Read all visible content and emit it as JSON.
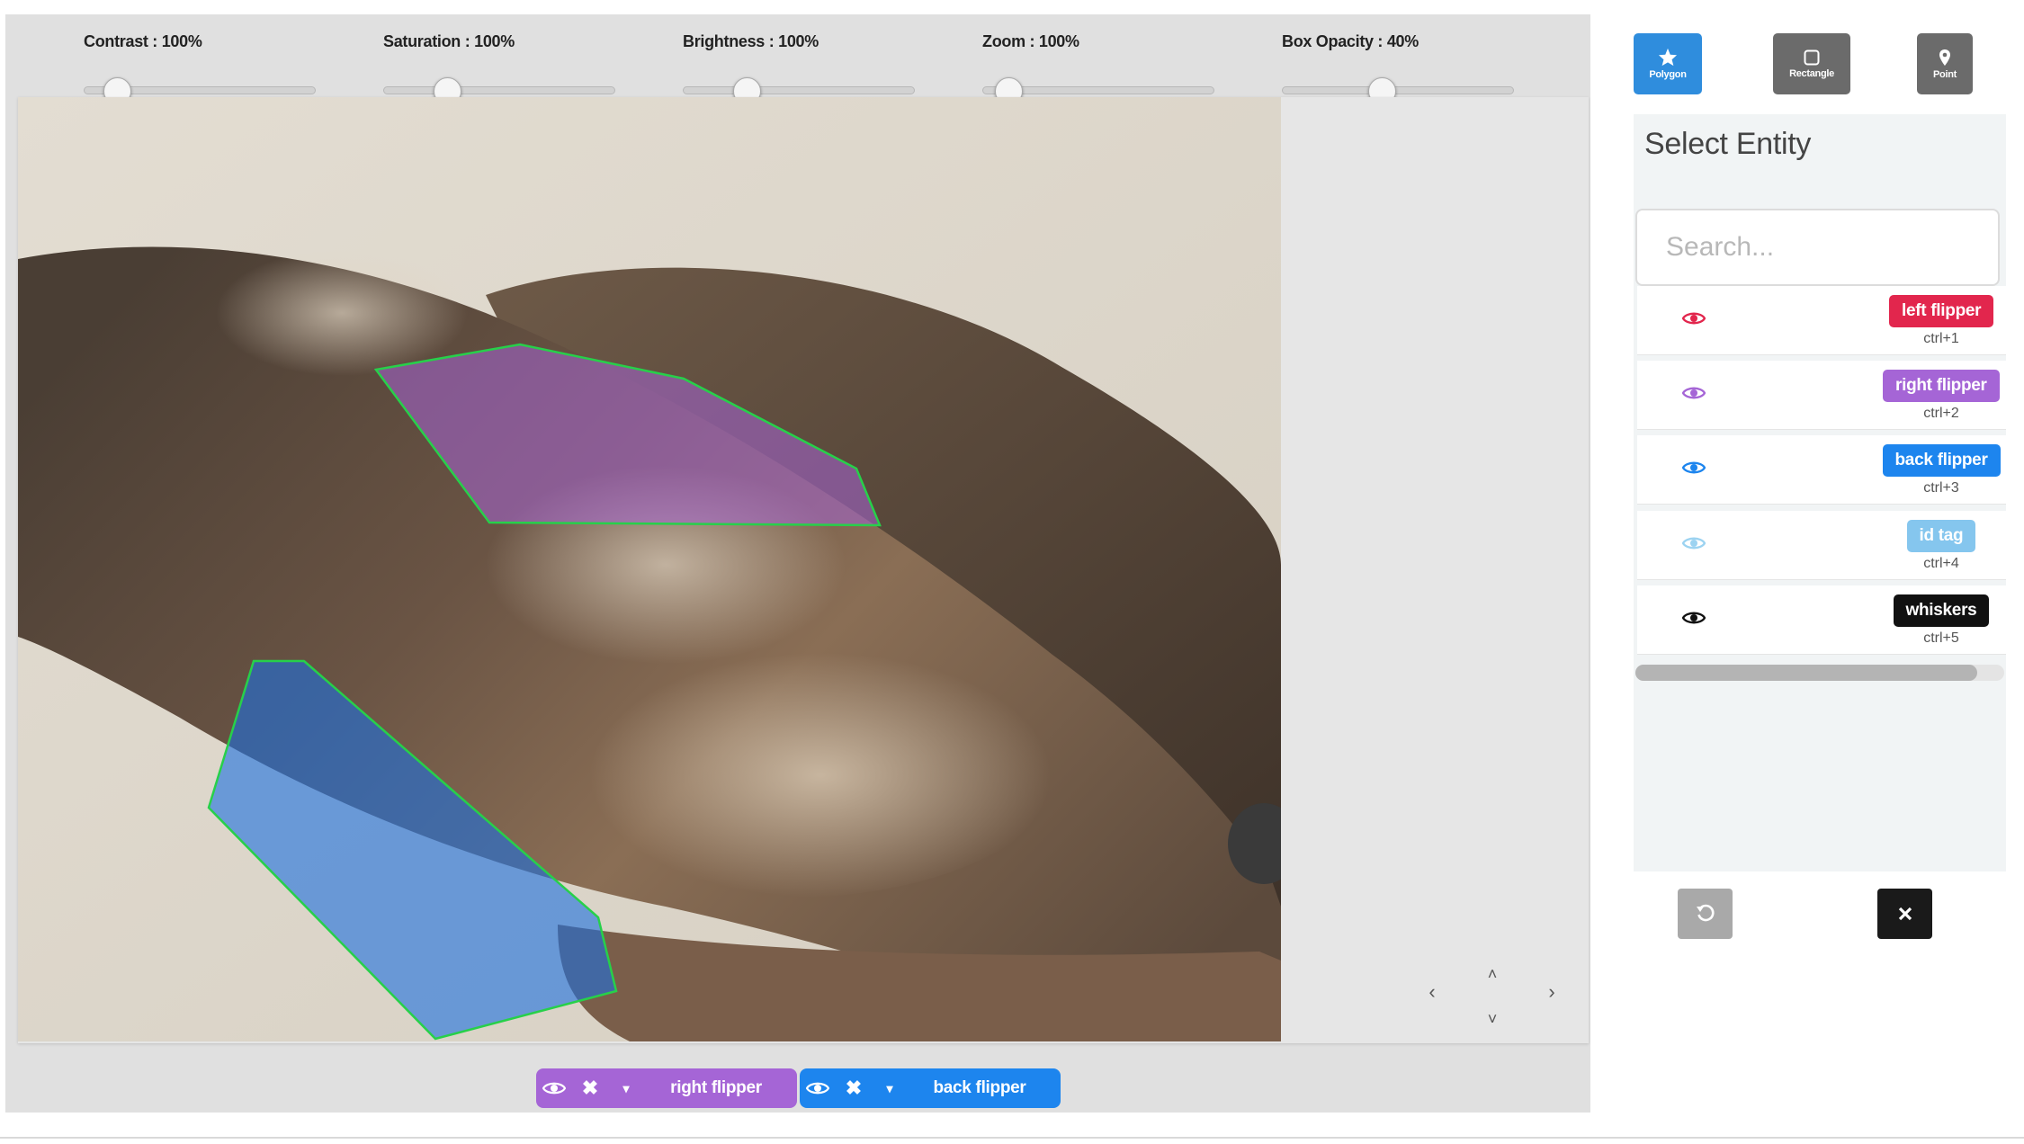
{
  "sliders": [
    {
      "label": "Contrast : 100%",
      "value_percent": 100
    },
    {
      "label": "Saturation : 100%",
      "value_percent": 100
    },
    {
      "label": "Brightness : 100%",
      "value_percent": 100
    },
    {
      "label": "Zoom : 100%",
      "value_percent": 100
    },
    {
      "label": "Box Opacity : 40%",
      "value_percent": 40
    }
  ],
  "tools": {
    "polygon": {
      "label": "Polygon",
      "color": "#2f8ddd"
    },
    "rectangle": {
      "label": "Rectangle",
      "color": "#6b6b6b"
    },
    "point": {
      "label": "Point",
      "color": "#6b6b6b"
    }
  },
  "entity_panel": {
    "title": "Select Entity",
    "search_placeholder": "Search...",
    "entities": [
      {
        "name": "left flipper",
        "shortcut": "ctrl+1",
        "color": "#e2264d",
        "eye_color": "#e2264d",
        "icon": "eye-icon"
      },
      {
        "name": "right flipper",
        "shortcut": "ctrl+2",
        "color": "#a565d6",
        "eye_color": "#a565d6",
        "icon": "eye-icon"
      },
      {
        "name": "back flipper",
        "shortcut": "ctrl+3",
        "color": "#1d85ee",
        "eye_color": "#1d85ee",
        "icon": "eye-icon"
      },
      {
        "name": "id tag",
        "shortcut": "ctrl+4",
        "color": "#85c6ee",
        "eye_color": "#9cd3f1",
        "icon": "eye-icon"
      },
      {
        "name": "whiskers",
        "shortcut": "ctrl+5",
        "color": "#111111",
        "eye_color": "#111111",
        "icon": "eye-icon"
      }
    ]
  },
  "annotation_chips": [
    {
      "label": "right flipper",
      "color": "#a565d6"
    },
    {
      "label": "back flipper",
      "color": "#1d85ee"
    }
  ],
  "actions": {
    "undo": {
      "icon": "undo-icon",
      "color": "#a9a9a9"
    },
    "close": {
      "icon": "close-icon",
      "color": "#1a1a1a"
    }
  },
  "navigation": {
    "icons": [
      "chevron-left-icon",
      "chevron-up-icon",
      "chevron-down-icon",
      "chevron-right-icon"
    ]
  }
}
